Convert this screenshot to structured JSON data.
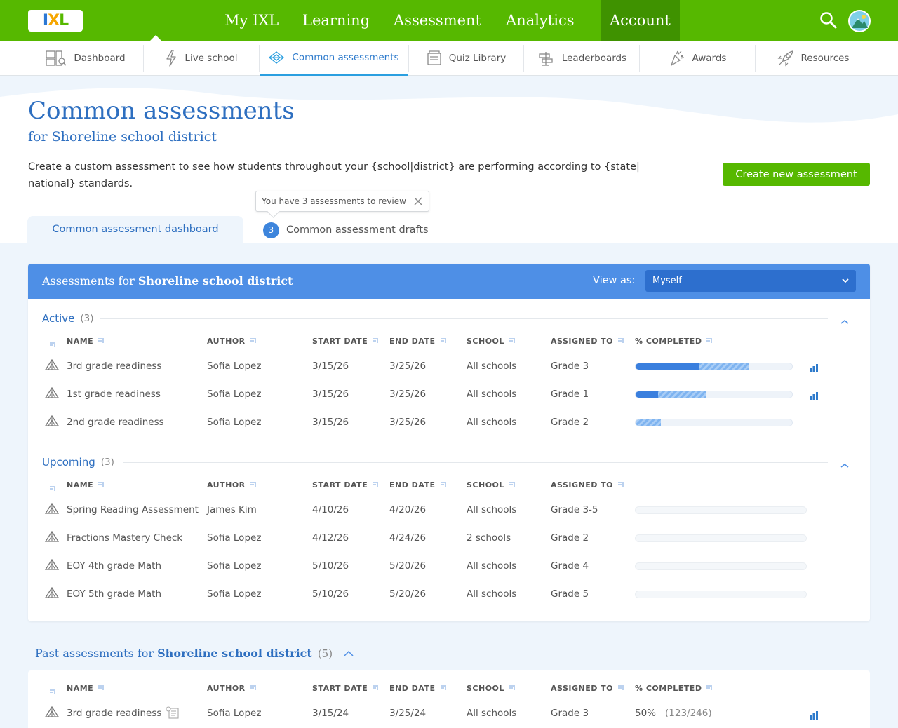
{
  "topnav": {
    "logo": "IXL",
    "items": [
      "My IXL",
      "Learning",
      "Assessment",
      "Analytics",
      "Account"
    ]
  },
  "subnav": {
    "items": [
      "Dashboard",
      "Live school",
      "Common assessments",
      "Quiz Library",
      "Leaderboards",
      "Awards",
      "Resources"
    ]
  },
  "page": {
    "title": "Common assessments",
    "subtitle": "for Shoreline school district",
    "description": "Create a custom assessment to see how students throughout your {school|district} are performing according to {state| national} standards.",
    "create_button": "Create new assessment"
  },
  "tabs": {
    "dashboard": "Common assessment dashboard",
    "drafts": "Common assessment drafts",
    "drafts_count": "3",
    "tooltip": "You have 3 assessments to review"
  },
  "card": {
    "title_prefix": "Assessments for ",
    "title_bold": "Shoreline school district",
    "view_as_label": "View as:",
    "view_as_value": "Myself"
  },
  "columns": {
    "name": "NAME",
    "author": "AUTHOR",
    "start": "START DATE",
    "end": "END DATE",
    "school": "SCHOOL",
    "assigned": "ASSIGNED TO",
    "completed": "% COMPLETED"
  },
  "active": {
    "label": "Active",
    "count": "(3)",
    "rows": [
      {
        "name": "3rd grade readiness",
        "author": "Sofia Lopez",
        "start": "3/15/26",
        "end": "3/25/26",
        "school": "All schools",
        "assigned": "Grade 3",
        "completed": 0.4,
        "in_progress": 0.32,
        "stats": true
      },
      {
        "name": "1st grade readiness",
        "author": "Sofia Lopez",
        "start": "3/15/26",
        "end": "3/25/26",
        "school": "All schools",
        "assigned": "Grade 1",
        "completed": 0.14,
        "in_progress": 0.31,
        "stats": true
      },
      {
        "name": "2nd grade readiness",
        "author": "Sofia Lopez",
        "start": "3/15/26",
        "end": "3/25/26",
        "school": "All schools",
        "assigned": "Grade 2",
        "completed": 0.0,
        "in_progress": 0.16,
        "stats": false
      }
    ]
  },
  "upcoming": {
    "label": "Upcoming",
    "count": "(3)",
    "rows": [
      {
        "name": "Spring Reading Assessment",
        "author": "James Kim",
        "start": "4/10/26",
        "end": "4/20/26",
        "school": "All schools",
        "assigned": "Grade 3-5"
      },
      {
        "name": "Fractions Mastery Check",
        "author": "Sofia Lopez",
        "start": "4/12/26",
        "end": "4/24/26",
        "school": "2 schools",
        "assigned": "Grade 2"
      },
      {
        "name": "EOY 4th grade Math",
        "author": "Sofia Lopez",
        "start": "5/10/26",
        "end": "5/20/26",
        "school": "All schools",
        "assigned": "Grade 4"
      },
      {
        "name": "EOY 5th grade Math",
        "author": "Sofia Lopez",
        "start": "5/10/26",
        "end": "5/20/26",
        "school": "All schools",
        "assigned": "Grade 5"
      }
    ]
  },
  "past": {
    "title_prefix": "Past assessments for ",
    "title_bold": "Shoreline school district",
    "count": "(5)",
    "rows": [
      {
        "name": "3rd grade readiness",
        "author": "Sofia Lopez",
        "start": "3/15/24",
        "end": "3/25/24",
        "school": "All schools",
        "assigned": "Grade 3",
        "percent": "50%",
        "fraction": "(123/246)"
      }
    ]
  },
  "colors": {
    "green": "#56b800",
    "blue_header": "#4e8fe6",
    "title_blue": "#2e6fc0"
  }
}
